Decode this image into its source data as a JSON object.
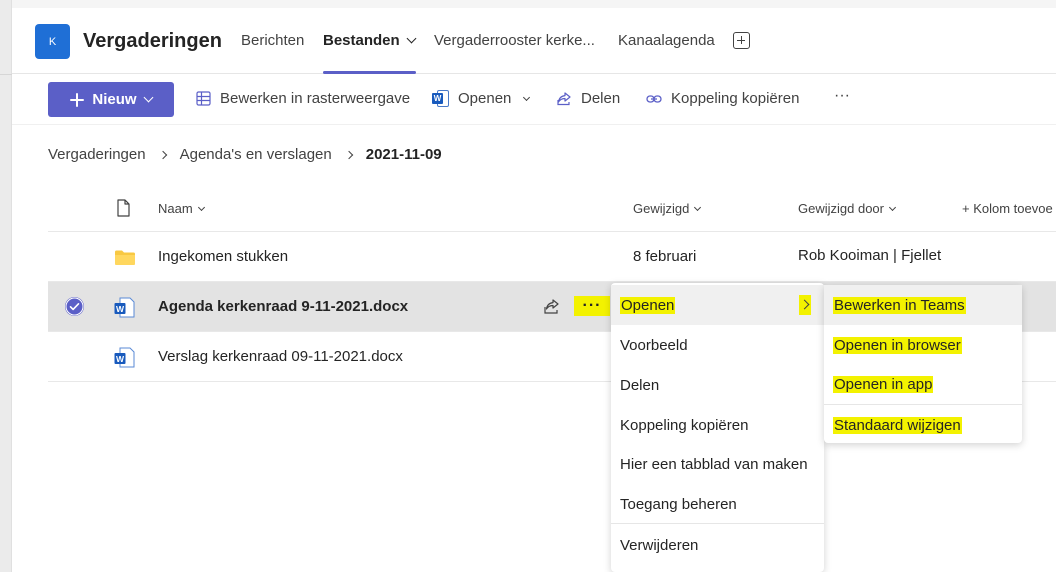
{
  "header": {
    "team_avatar_letter": "K",
    "channel_title": "Vergaderingen",
    "tabs": [
      {
        "label": "Berichten"
      },
      {
        "label": "Bestanden"
      },
      {
        "label": "Vergaderrooster kerke..."
      },
      {
        "label": "Kanaalagenda"
      }
    ]
  },
  "toolbar": {
    "new_label": "Nieuw",
    "grid_label": "Bewerken in rasterweergave",
    "open_label": "Openen",
    "share_label": "Delen",
    "copy_link_label": "Koppeling kopiëren",
    "more_label": "···"
  },
  "breadcrumb": {
    "items": [
      "Vergaderingen",
      "Agenda's en verslagen",
      "2021-11-09"
    ]
  },
  "columns": {
    "name": "Naam",
    "modified": "Gewijzigd",
    "modified_by": "Gewijzigd door",
    "add_column": "+ Kolom toevoe"
  },
  "files": [
    {
      "name": "Ingekomen stukken",
      "modified": "8 februari",
      "modified_by": "Rob Kooiman | Fjellet"
    },
    {
      "name": "Agenda kerkenraad 9-11-2021.docx"
    },
    {
      "name": "Verslag kerkenraad 09-11-2021.docx"
    }
  ],
  "context_menu": {
    "items": [
      "Openen",
      "Voorbeeld",
      "Delen",
      "Koppeling kopiëren",
      "Hier een tabblad van maken",
      "Toegang beheren",
      "Verwijderen"
    ]
  },
  "submenu": {
    "items": [
      "Bewerken in Teams",
      "Openen in browser",
      "Openen in app",
      "Standaard wijzigen"
    ]
  },
  "colors": {
    "accent": "#5b5fc7",
    "highlight": "#f3f200",
    "team_avatar": "#1f6fd6",
    "word_blue": "#185abd",
    "folder_yellow": "#f8c842"
  }
}
